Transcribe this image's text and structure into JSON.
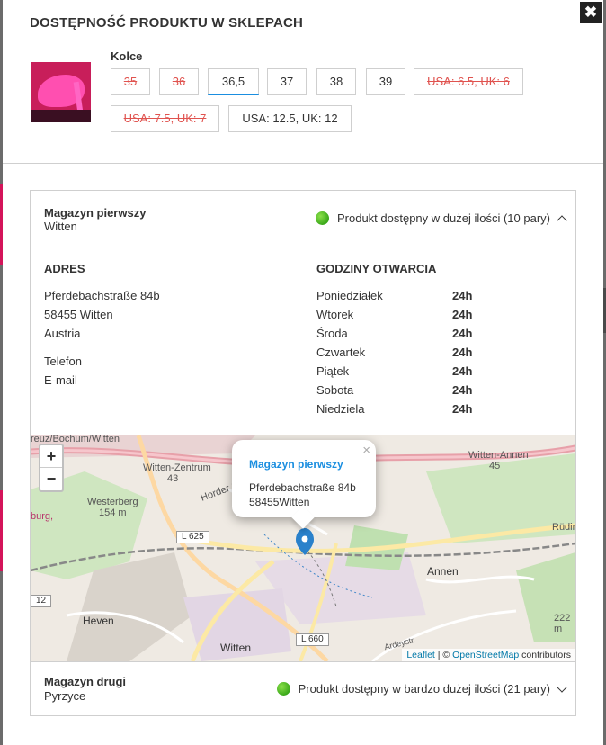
{
  "dialog": {
    "title": "DOSTĘPNOŚĆ PRODUKTU W SKLEPACH",
    "close_icon": "close-icon"
  },
  "product": {
    "name": "Kolce",
    "sizes": [
      {
        "label": "35",
        "available": false,
        "selected": false
      },
      {
        "label": "36",
        "available": false,
        "selected": false
      },
      {
        "label": "36,5",
        "available": true,
        "selected": true
      },
      {
        "label": "37",
        "available": true,
        "selected": false
      },
      {
        "label": "38",
        "available": true,
        "selected": false
      },
      {
        "label": "39",
        "available": true,
        "selected": false
      },
      {
        "label": "USA: 6.5, UK: 6",
        "available": false,
        "selected": false
      },
      {
        "label": "USA: 7.5, UK: 7",
        "available": false,
        "selected": false
      },
      {
        "label": "USA: 12.5, UK: 12",
        "available": true,
        "selected": false
      }
    ]
  },
  "stores": [
    {
      "name": "Magazyn pierwszy",
      "city": "Witten",
      "availability": "Produkt dostępny w dużej ilości (10 pary)",
      "expanded": true,
      "address_title": "ADRES",
      "address": [
        "Pferdebachstraße 84b",
        "58455 Witten",
        "Austria"
      ],
      "contact": [
        "Telefon",
        "E-mail"
      ],
      "hours_title": "GODZINY OTWARCIA",
      "hours": [
        {
          "day": "Poniedziałek",
          "value": "24h"
        },
        {
          "day": "Wtorek",
          "value": "24h"
        },
        {
          "day": "Środa",
          "value": "24h"
        },
        {
          "day": "Czwartek",
          "value": "24h"
        },
        {
          "day": "Piątek",
          "value": "24h"
        },
        {
          "day": "Sobota",
          "value": "24h"
        },
        {
          "day": "Niedziela",
          "value": "24h"
        }
      ],
      "map": {
        "zoom_in": "+",
        "zoom_out": "−",
        "popup_close": "×",
        "popup_title": "Magazyn pierwszy",
        "popup_street": "Pferdebachstraße 84b",
        "popup_city": "58455Witten",
        "labels": {
          "bochum": "reuz/Bochum/Witten",
          "zentrum": "Witten-Zentrum",
          "zentrum_num": "43",
          "annen_exit": "Witten-Annen",
          "annen_num": "45",
          "westerberg": "Westerberg",
          "westerberg_h": "154 m",
          "burg": "burg,",
          "hdr": "Horder Str.",
          "rudin": "Rüdin",
          "annen": "Annen",
          "heven": "Heven",
          "witten": "Witten",
          "ardey": "Ardeystr.",
          "h222": "222 m",
          "l625": "L 625",
          "l660": "L 660",
          "n12": "12"
        },
        "attribution_leaflet": "Leaflet",
        "attribution_sep": " | © ",
        "attribution_osm": "OpenStreetMap",
        "attribution_tail": " contributors"
      }
    },
    {
      "name": "Magazyn drugi",
      "city": "Pyrzyce",
      "availability": "Produkt dostępny w bardzo dużej ilości (21 pary)",
      "expanded": false
    }
  ]
}
